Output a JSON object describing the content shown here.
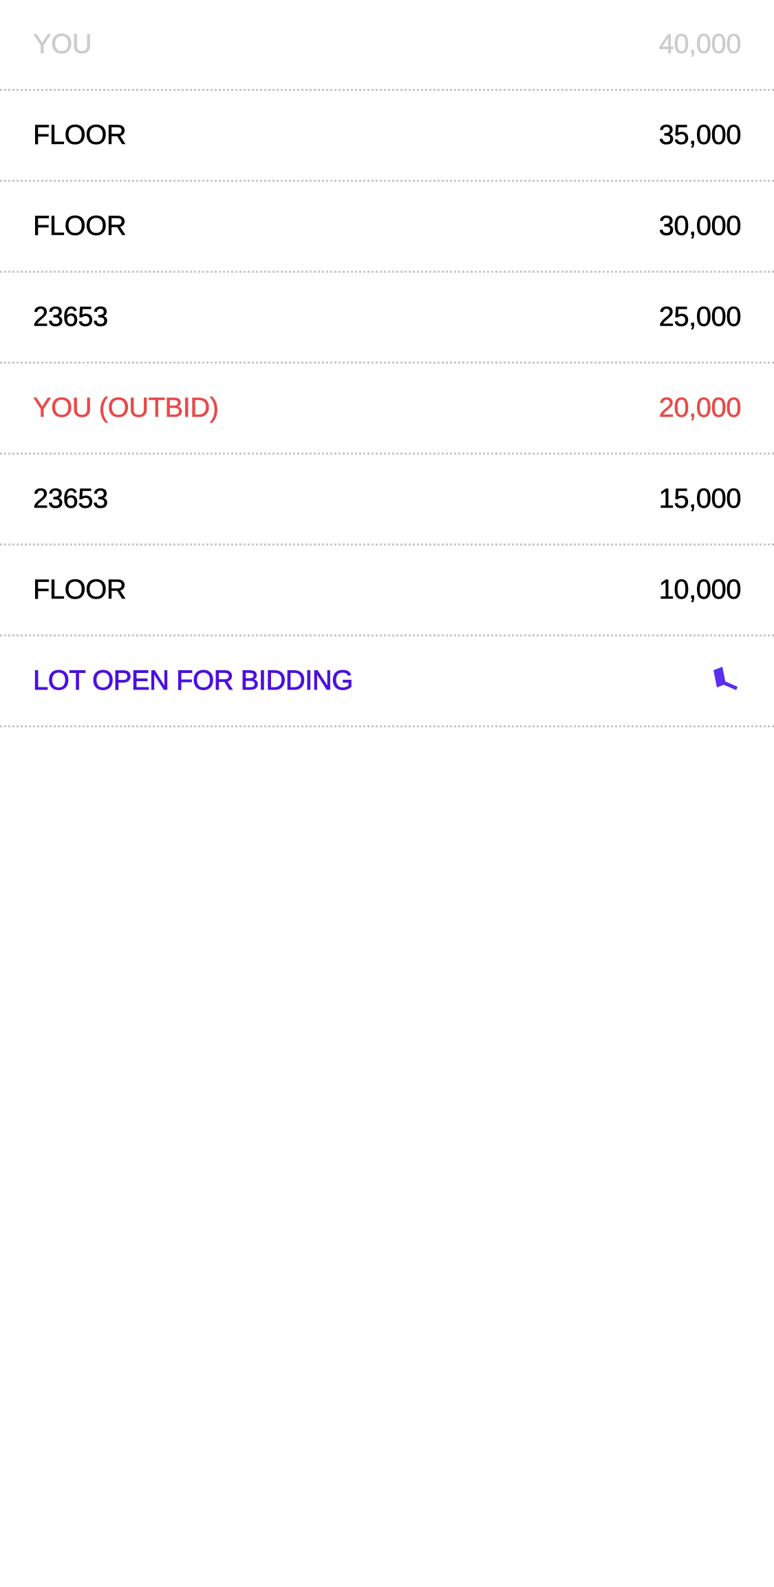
{
  "bids": [
    {
      "bidder": "YOU",
      "amount": "40,000",
      "state": "pending"
    },
    {
      "bidder": "FLOOR",
      "amount": "35,000",
      "state": "normal"
    },
    {
      "bidder": "FLOOR",
      "amount": "30,000",
      "state": "normal"
    },
    {
      "bidder": "23653",
      "amount": "25,000",
      "state": "normal"
    },
    {
      "bidder": "YOU (OUTBID)",
      "amount": "20,000",
      "state": "outbid"
    },
    {
      "bidder": "23653",
      "amount": "15,000",
      "state": "normal"
    },
    {
      "bidder": "FLOOR",
      "amount": "10,000",
      "state": "normal"
    }
  ],
  "status": {
    "label": "LOT OPEN FOR BIDDING",
    "icon": "gavel-icon"
  },
  "colors": {
    "pending": "#cccccc",
    "normal": "#000000",
    "outbid": "#e84a4a",
    "status": "#4a10e0",
    "divider": "#c8c8c8"
  }
}
